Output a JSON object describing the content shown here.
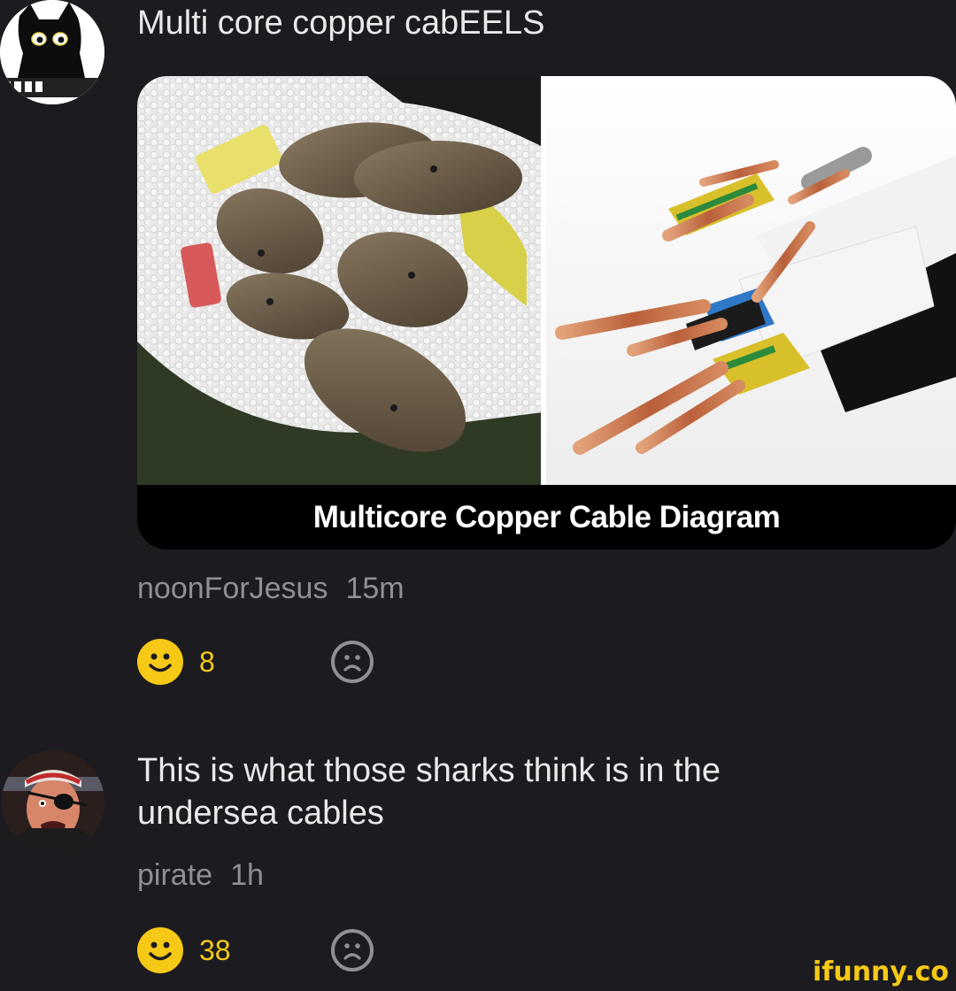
{
  "comments": [
    {
      "text": "Multi core copper cabEELS",
      "meme_caption": "Multicore Copper Cable Diagram",
      "username": "noonForJesus",
      "time": "15m",
      "smiles": "8"
    },
    {
      "text_line1": "This is what those sharks think is in the",
      "text_line2": "undersea cables",
      "username": "pirate",
      "time": "1h",
      "smiles": "38"
    }
  ],
  "watermark": "ifunny.co",
  "colors": {
    "background": "#1c1b20",
    "accent": "#f6c916",
    "muted": "#8f8f96"
  }
}
